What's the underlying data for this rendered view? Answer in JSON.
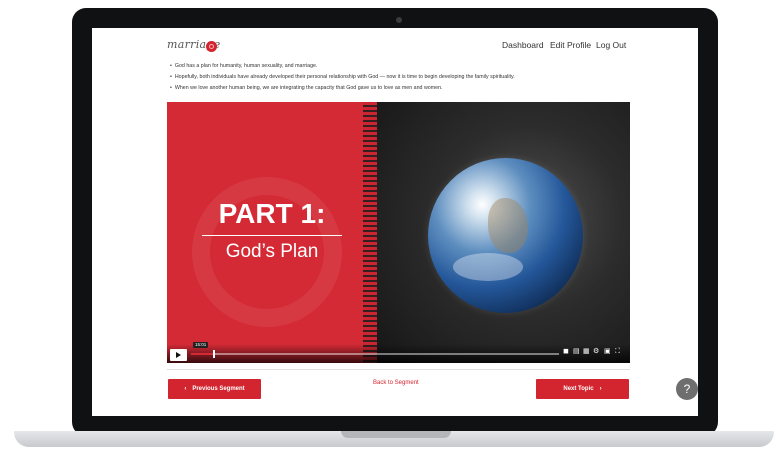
{
  "header": {
    "logo_text": "marriage",
    "nav": {
      "dashboard": "Dashboard",
      "edit_profile": "Edit Profile",
      "log_out": "Log Out"
    }
  },
  "bullets": [
    "God has a plan for humanity, human sexuality, and marriage.",
    "Hopefully, both individuals have already developed their personal relationship with God — now it is time to begin developing the family spirituality.",
    "When we love another human being, we are integrating the capacity that God gave us to love as men and women."
  ],
  "video": {
    "title_line1": "PART 1:",
    "title_line2": "God’s Plan",
    "time_badge": "15:01",
    "progress_fraction": 0.06,
    "accent_color": "#d42a35",
    "icons": [
      "play-icon",
      "volume-icon",
      "captions-icon",
      "chapters-icon",
      "settings-icon",
      "pip-icon",
      "fullscreen-icon"
    ]
  },
  "footer": {
    "prev_label": "Previous Segment",
    "prev_chevron": "‹",
    "back_label": "Back to Segment",
    "next_label": "Next Topic",
    "next_chevron": "›",
    "help_label": "?"
  },
  "colors": {
    "brand_red": "#d32530",
    "help_gray": "#6e6e6e"
  }
}
